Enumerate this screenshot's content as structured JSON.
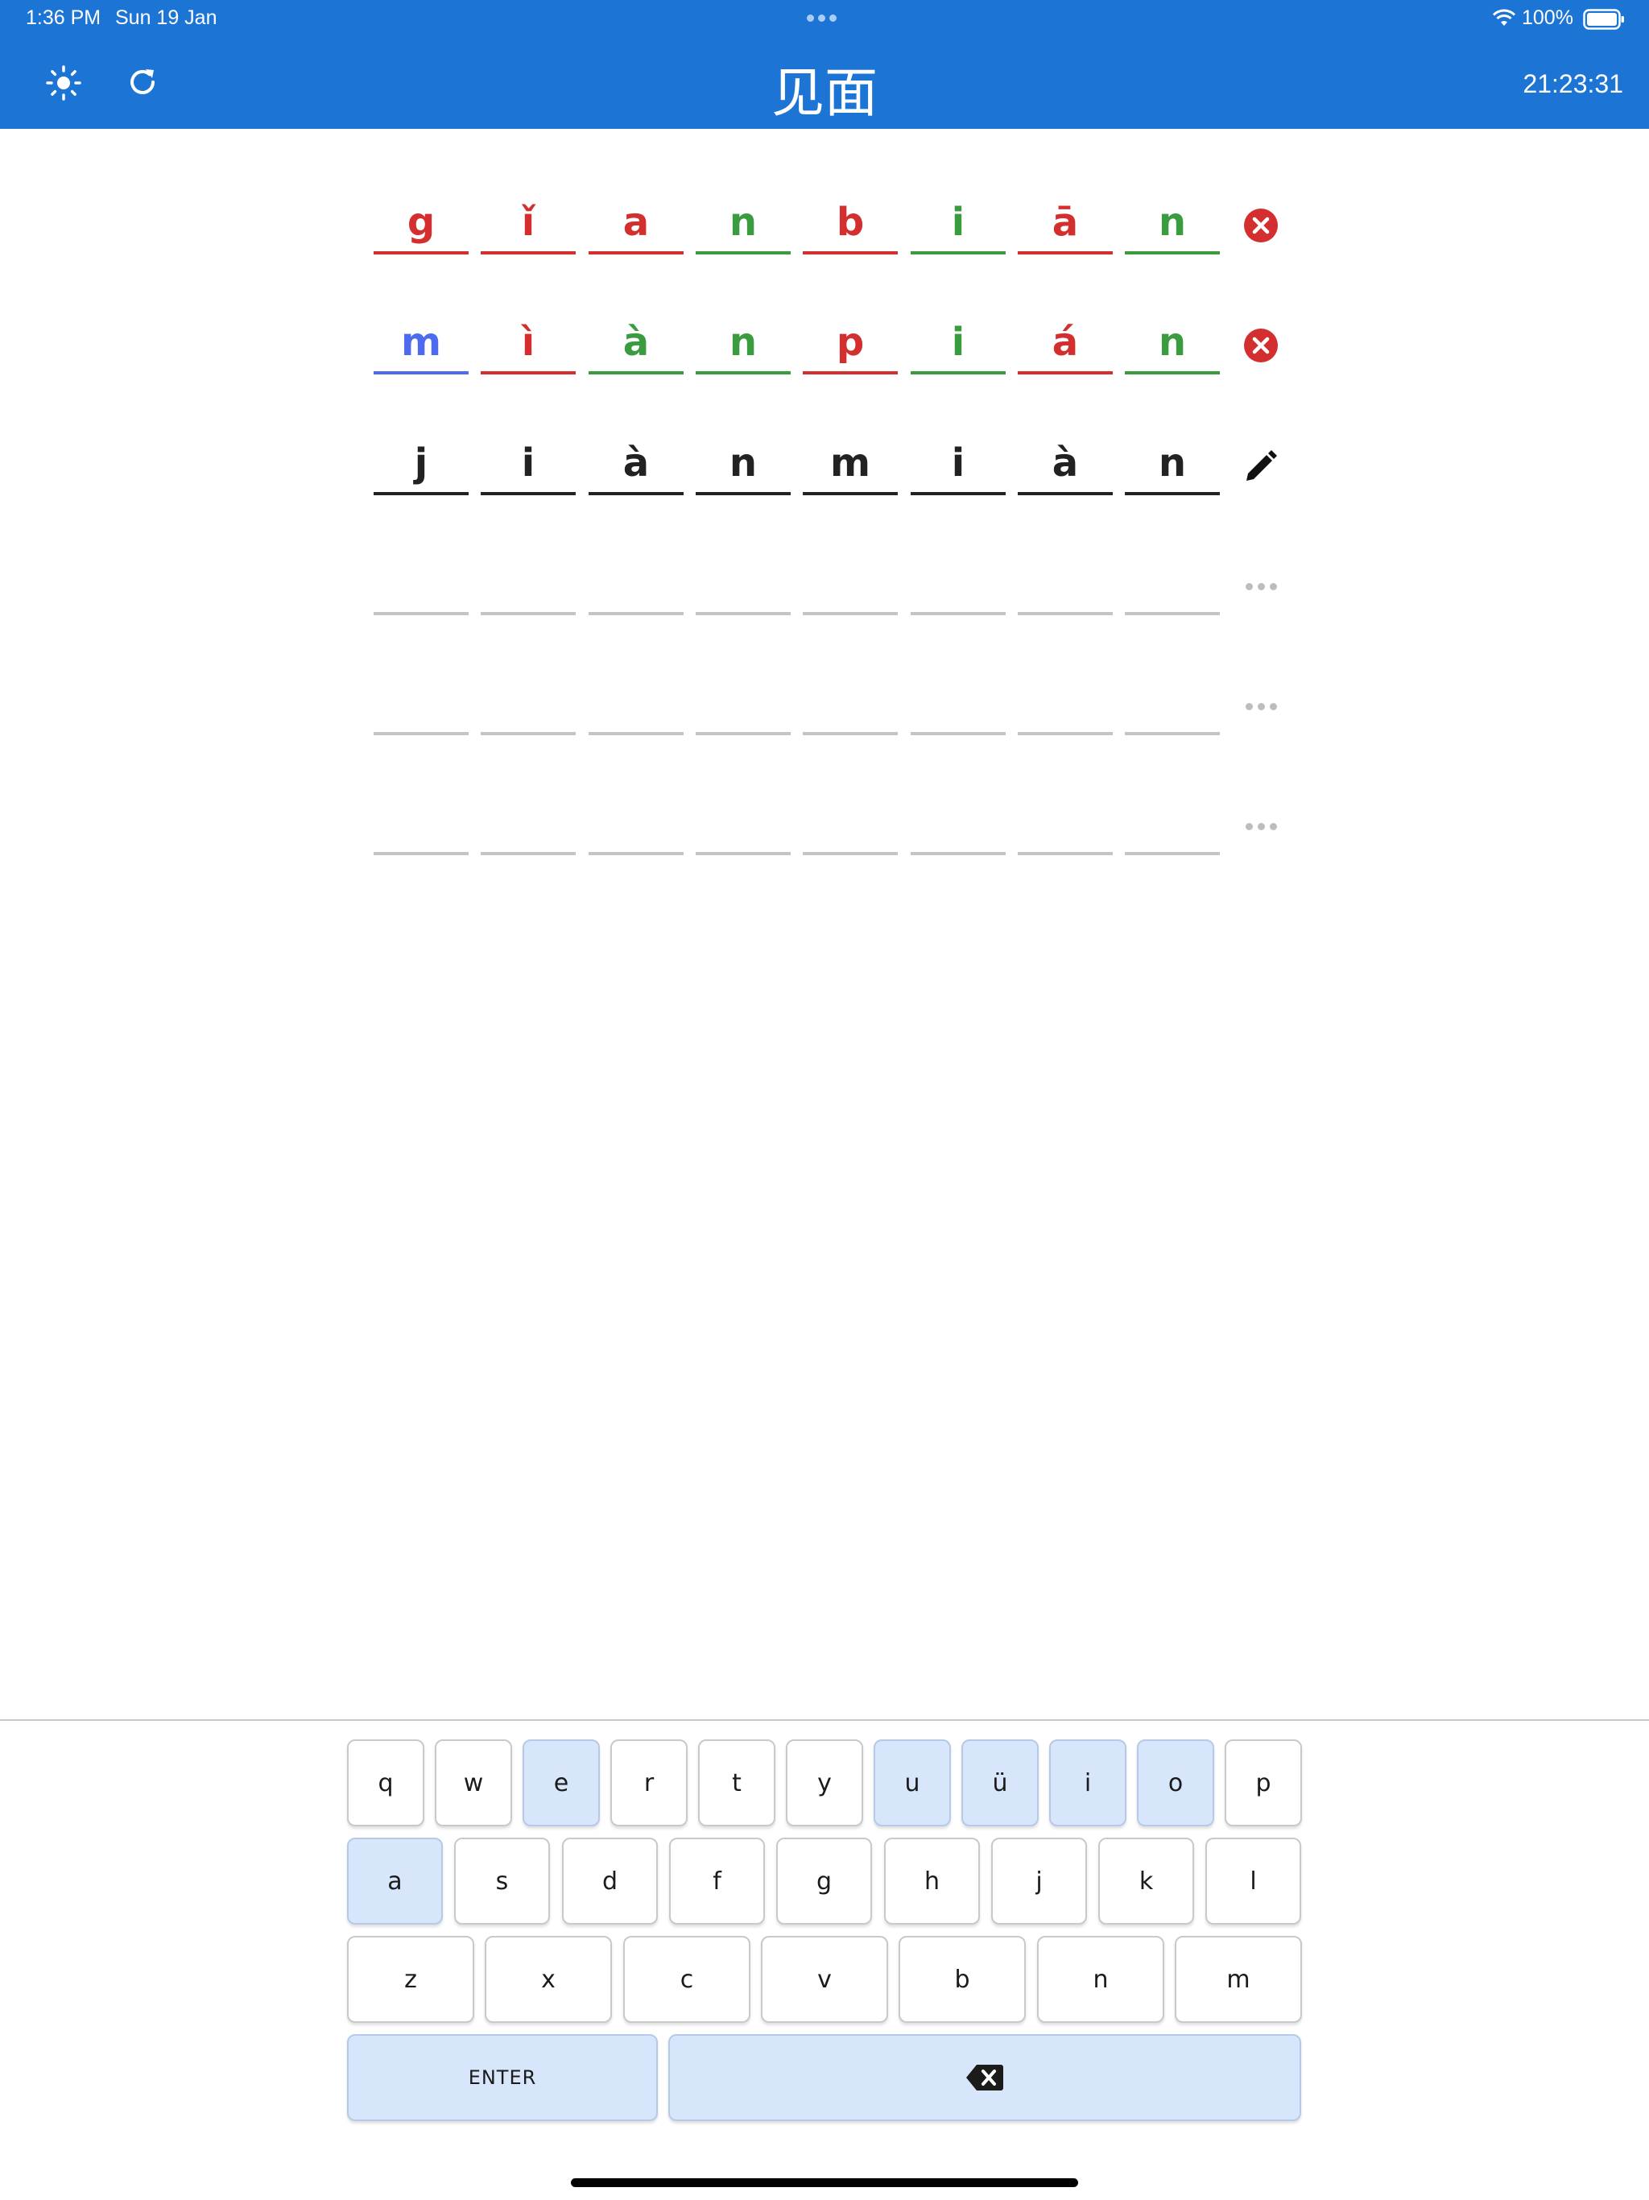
{
  "status_bar": {
    "time": "1:36 PM",
    "date": "Sun 19 Jan",
    "battery": "100%"
  },
  "header": {
    "title": "见面",
    "timer": "21:23:31",
    "brightness_icon": "sun-icon",
    "refresh_icon": "refresh-icon"
  },
  "colors": {
    "accent": "#1c74d4",
    "correct": "#3a9b3f",
    "wrong": "#d32f2f",
    "partial": "#4e6bf0",
    "neutral": "#222222",
    "empty": "#c4c4c4"
  },
  "grid": {
    "rows": [
      {
        "status": "submitted",
        "icon": "error-circle-icon",
        "cells": [
          {
            "ch": "g",
            "state": "wrong"
          },
          {
            "ch": "ǐ",
            "state": "wrong"
          },
          {
            "ch": "a",
            "state": "wrong"
          },
          {
            "ch": "n",
            "state": "correct"
          },
          {
            "ch": "b",
            "state": "wrong"
          },
          {
            "ch": "i",
            "state": "correct"
          },
          {
            "ch": "ā",
            "state": "wrong"
          },
          {
            "ch": "n",
            "state": "correct"
          }
        ]
      },
      {
        "status": "submitted",
        "icon": "error-circle-icon",
        "cells": [
          {
            "ch": "m",
            "state": "partial"
          },
          {
            "ch": "ì",
            "state": "wrong"
          },
          {
            "ch": "à",
            "state": "correct"
          },
          {
            "ch": "n",
            "state": "correct"
          },
          {
            "ch": "p",
            "state": "wrong"
          },
          {
            "ch": "i",
            "state": "correct"
          },
          {
            "ch": "á",
            "state": "wrong"
          },
          {
            "ch": "n",
            "state": "correct"
          }
        ]
      },
      {
        "status": "editing",
        "icon": "pencil-icon",
        "cells": [
          {
            "ch": "j",
            "state": "neutral"
          },
          {
            "ch": "i",
            "state": "neutral"
          },
          {
            "ch": "à",
            "state": "neutral"
          },
          {
            "ch": "n",
            "state": "neutral"
          },
          {
            "ch": "m",
            "state": "neutral"
          },
          {
            "ch": "i",
            "state": "neutral"
          },
          {
            "ch": "à",
            "state": "neutral"
          },
          {
            "ch": "n",
            "state": "neutral"
          }
        ]
      },
      {
        "status": "empty",
        "icon": "more-dots-icon",
        "cells": [
          {
            "ch": "",
            "state": "empty"
          },
          {
            "ch": "",
            "state": "empty"
          },
          {
            "ch": "",
            "state": "empty"
          },
          {
            "ch": "",
            "state": "empty"
          },
          {
            "ch": "",
            "state": "empty"
          },
          {
            "ch": "",
            "state": "empty"
          },
          {
            "ch": "",
            "state": "empty"
          },
          {
            "ch": "",
            "state": "empty"
          }
        ]
      },
      {
        "status": "empty",
        "icon": "more-dots-icon",
        "cells": [
          {
            "ch": "",
            "state": "empty"
          },
          {
            "ch": "",
            "state": "empty"
          },
          {
            "ch": "",
            "state": "empty"
          },
          {
            "ch": "",
            "state": "empty"
          },
          {
            "ch": "",
            "state": "empty"
          },
          {
            "ch": "",
            "state": "empty"
          },
          {
            "ch": "",
            "state": "empty"
          },
          {
            "ch": "",
            "state": "empty"
          }
        ]
      },
      {
        "status": "empty",
        "icon": "more-dots-icon",
        "cells": [
          {
            "ch": "",
            "state": "empty"
          },
          {
            "ch": "",
            "state": "empty"
          },
          {
            "ch": "",
            "state": "empty"
          },
          {
            "ch": "",
            "state": "empty"
          },
          {
            "ch": "",
            "state": "empty"
          },
          {
            "ch": "",
            "state": "empty"
          },
          {
            "ch": "",
            "state": "empty"
          },
          {
            "ch": "",
            "state": "empty"
          }
        ]
      }
    ]
  },
  "keyboard": {
    "rows": [
      [
        {
          "label": "q"
        },
        {
          "label": "w"
        },
        {
          "label": "e",
          "highlight": true
        },
        {
          "label": "r"
        },
        {
          "label": "t"
        },
        {
          "label": "y"
        },
        {
          "label": "u",
          "highlight": true
        },
        {
          "label": "ü",
          "highlight": true
        },
        {
          "label": "i",
          "highlight": true
        },
        {
          "label": "o",
          "highlight": true
        },
        {
          "label": "p"
        }
      ],
      [
        {
          "label": "a",
          "highlight": true
        },
        {
          "label": "s"
        },
        {
          "label": "d"
        },
        {
          "label": "f"
        },
        {
          "label": "g"
        },
        {
          "label": "h"
        },
        {
          "label": "j"
        },
        {
          "label": "k"
        },
        {
          "label": "l"
        }
      ],
      [
        {
          "label": "z"
        },
        {
          "label": "x"
        },
        {
          "label": "c"
        },
        {
          "label": "v"
        },
        {
          "label": "b"
        },
        {
          "label": "n"
        },
        {
          "label": "m"
        }
      ]
    ],
    "enter_label": "ENTER",
    "backspace_icon": "backspace-icon"
  }
}
